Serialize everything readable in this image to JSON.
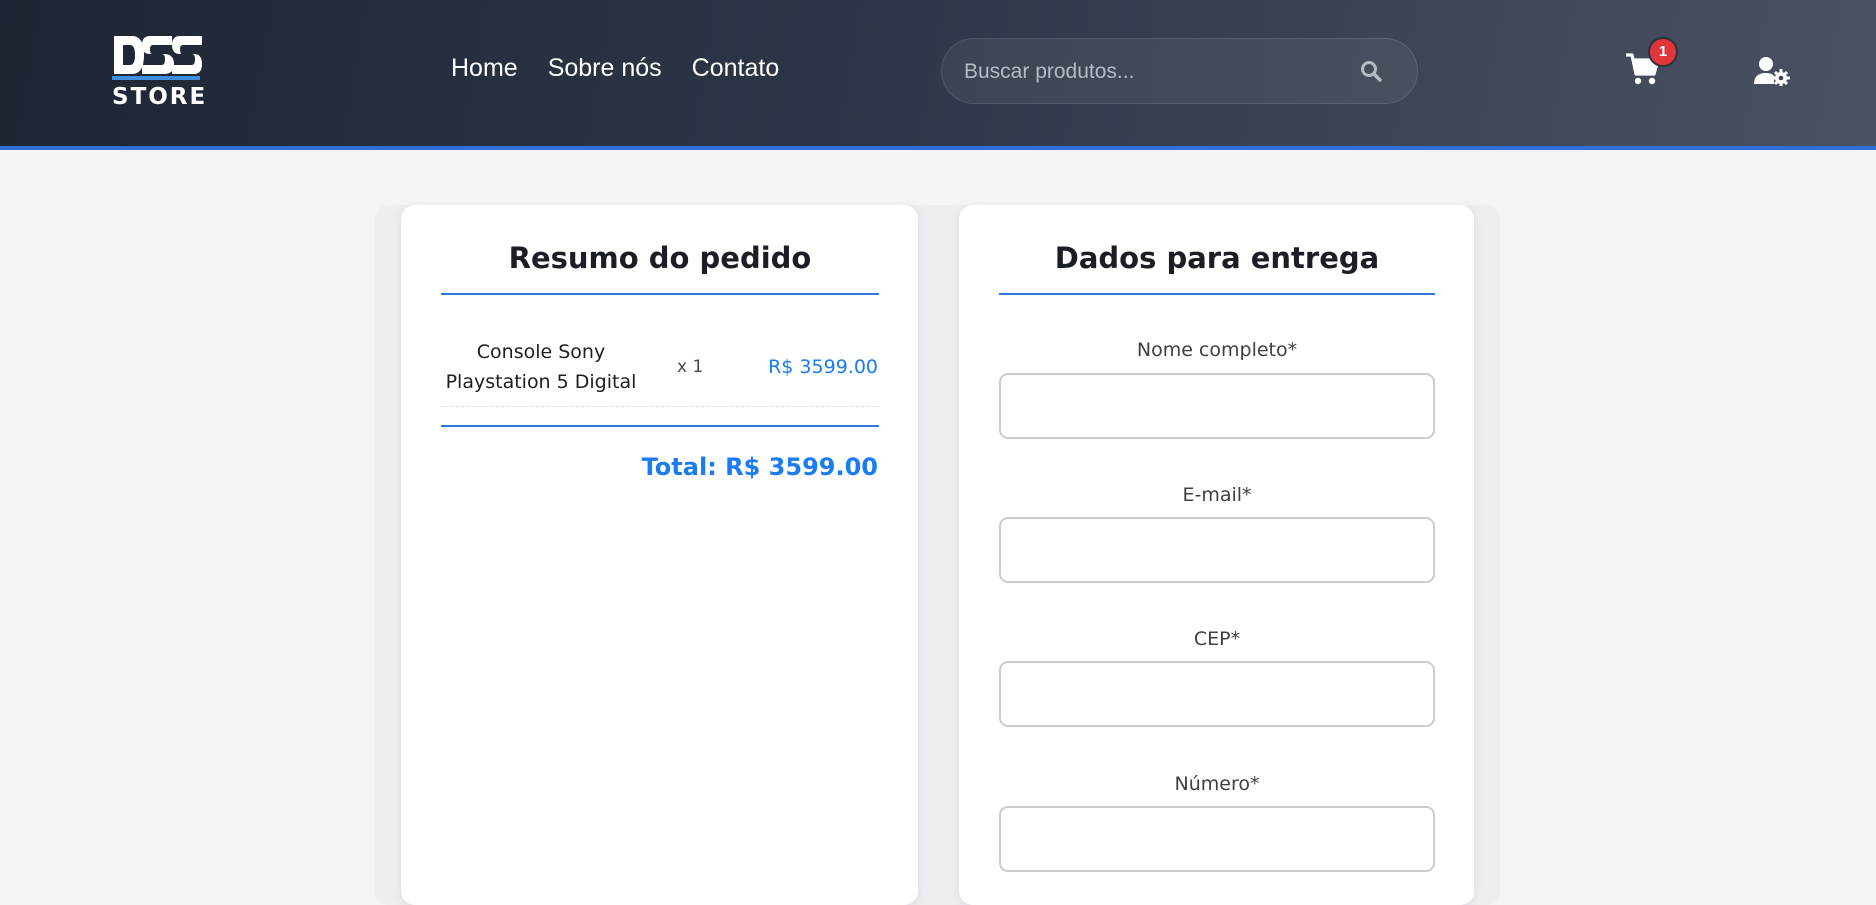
{
  "header": {
    "logo_text": "DSS",
    "logo_subtext": "STORE",
    "nav": [
      {
        "label": "Home"
      },
      {
        "label": "Sobre nós"
      },
      {
        "label": "Contato"
      }
    ],
    "search": {
      "placeholder": "Buscar produtos...",
      "value": ""
    },
    "cart": {
      "count": "1",
      "icon": "cart-icon"
    },
    "user_icon": "user-gear-icon"
  },
  "summary": {
    "title": "Resumo do pedido",
    "items": [
      {
        "name": "Console Sony Playstation 5 Digital",
        "qty": "x 1",
        "price": "R$ 3599.00"
      }
    ],
    "total": "Total: R$ 3599.00"
  },
  "delivery": {
    "title": "Dados para entrega",
    "fields": [
      {
        "label": "Nome completo*",
        "value": ""
      },
      {
        "label": "E-mail*",
        "value": ""
      },
      {
        "label": "CEP*",
        "value": ""
      },
      {
        "label": "Número*",
        "value": ""
      }
    ]
  },
  "colors": {
    "accent": "#1a7cf0",
    "header_dark": "#1e2534",
    "badge": "#e0353b",
    "rule": "#2b78d6"
  }
}
